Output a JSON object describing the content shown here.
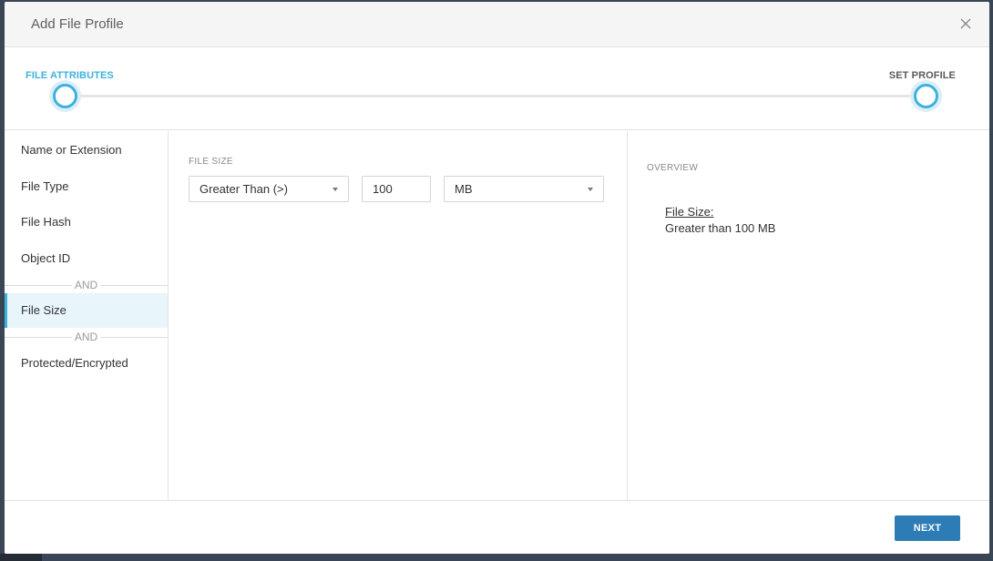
{
  "modal": {
    "title": "Add File Profile",
    "close_icon": "close-icon"
  },
  "stepper": {
    "steps": [
      {
        "label": "FILE ATTRIBUTES",
        "state": "active"
      },
      {
        "label": "SET PROFILE",
        "state": "inactive"
      }
    ]
  },
  "sidebar": {
    "items": [
      {
        "label": "Name or Extension",
        "selected": false
      },
      {
        "label": "File Type",
        "selected": false
      },
      {
        "label": "File Hash",
        "selected": false
      },
      {
        "label": "Object ID",
        "selected": false
      },
      {
        "label": "File Size",
        "selected": true
      },
      {
        "label": "Protected/Encrypted",
        "selected": false
      }
    ],
    "separator_label": "AND"
  },
  "main": {
    "section_label": "FILE SIZE",
    "operator_select": {
      "value": "Greater Than (>)"
    },
    "size_input": {
      "value": "100"
    },
    "unit_select": {
      "value": "MB"
    }
  },
  "overview": {
    "heading": "OVERVIEW",
    "key": "File Size:",
    "value": "Greater than 100 MB"
  },
  "footer": {
    "next_label": "NEXT"
  },
  "colors": {
    "accent": "#3cb2dc",
    "primary_button": "#2d7cb5",
    "selected_row": "#e8f5fa"
  }
}
